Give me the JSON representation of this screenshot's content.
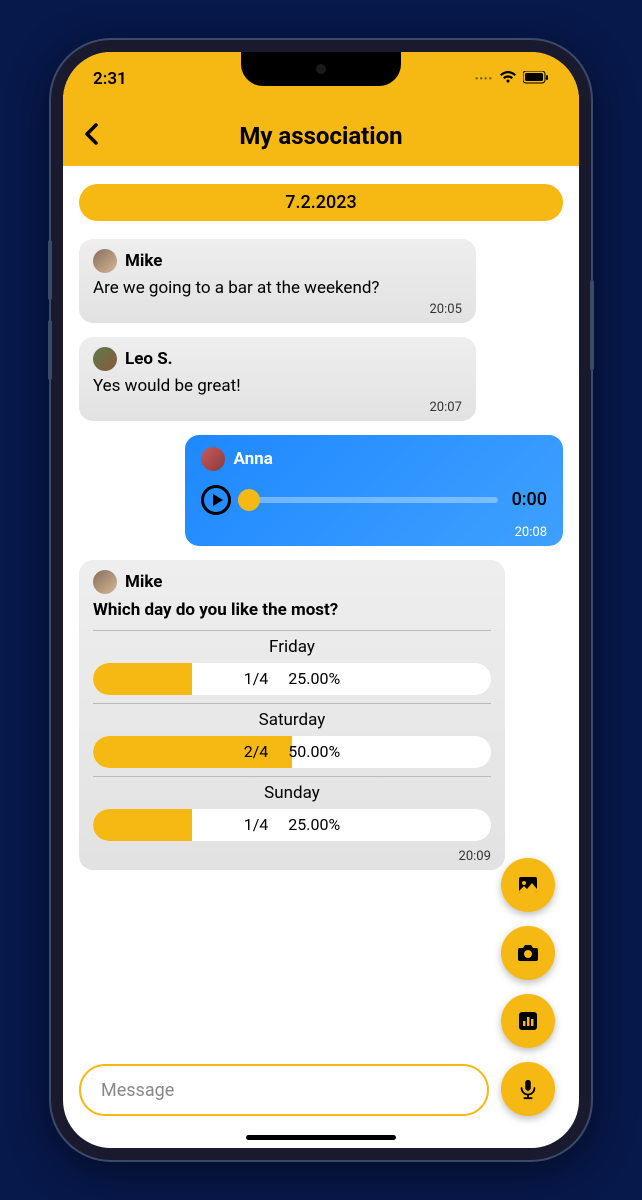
{
  "status": {
    "time": "2:31"
  },
  "header": {
    "title": "My association"
  },
  "date_badge": "7.2.2023",
  "messages": {
    "m1": {
      "sender": "Mike",
      "text": "Are we going to a bar at the weekend?",
      "time": "20:05"
    },
    "m2": {
      "sender": "Leo S.",
      "text": "Yes would be great!",
      "time": "20:07"
    },
    "m3": {
      "sender": "Anna",
      "duration": "0:00",
      "time": "20:08"
    },
    "m4": {
      "sender": "Mike",
      "question": "Which day do you like the most?",
      "time": "20:09",
      "opts": {
        "o1": {
          "label": "Friday",
          "count": "1/4",
          "percent": "25.00%"
        },
        "o2": {
          "label": "Saturday",
          "count": "2/4",
          "percent": "50.00%"
        },
        "o3": {
          "label": "Sunday",
          "count": "1/4",
          "percent": "25.00%"
        }
      }
    }
  },
  "input": {
    "placeholder": "Message"
  }
}
